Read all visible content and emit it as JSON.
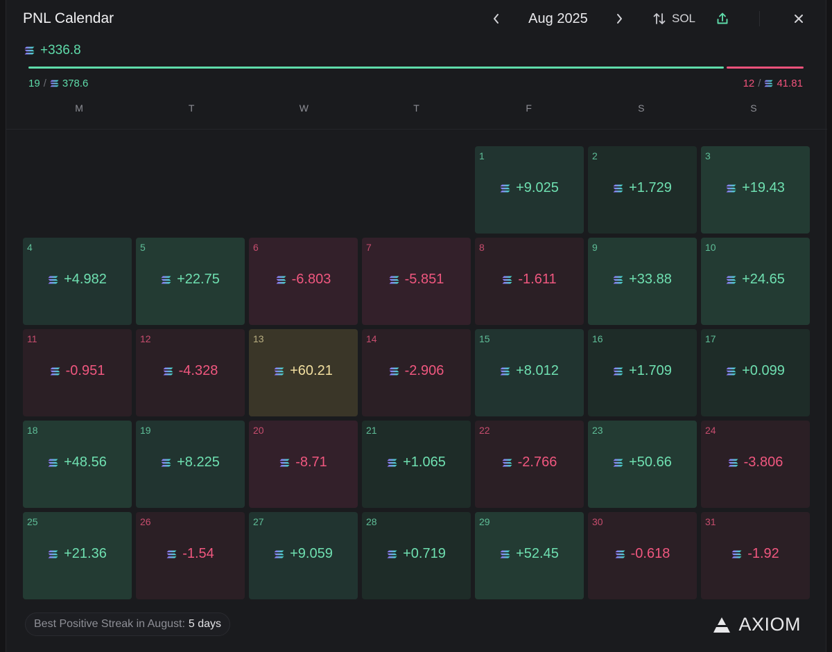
{
  "header": {
    "title": "PNL Calendar",
    "month": "Aug 2025",
    "unit_label": "SOL"
  },
  "summary": {
    "total": "+336.8",
    "wins_count": "19",
    "wins_amount": "378.6",
    "losses_count": "12",
    "losses_amount": "41.81",
    "win_share": 0.9
  },
  "weekdays": [
    "M",
    "T",
    "W",
    "T",
    "F",
    "S",
    "S"
  ],
  "days": [
    {
      "day": "1",
      "value": "+9.025"
    },
    {
      "day": "2",
      "value": "+1.729"
    },
    {
      "day": "3",
      "value": "+19.43"
    },
    {
      "day": "4",
      "value": "+4.982"
    },
    {
      "day": "5",
      "value": "+22.75"
    },
    {
      "day": "6",
      "value": "-6.803"
    },
    {
      "day": "7",
      "value": "-5.851"
    },
    {
      "day": "8",
      "value": "-1.611"
    },
    {
      "day": "9",
      "value": "+33.88"
    },
    {
      "day": "10",
      "value": "+24.65"
    },
    {
      "day": "11",
      "value": "-0.951"
    },
    {
      "day": "12",
      "value": "-4.328"
    },
    {
      "day": "13",
      "value": "+60.21"
    },
    {
      "day": "14",
      "value": "-2.906"
    },
    {
      "day": "15",
      "value": "+8.012"
    },
    {
      "day": "16",
      "value": "+1.709"
    },
    {
      "day": "17",
      "value": "+0.099"
    },
    {
      "day": "18",
      "value": "+48.56"
    },
    {
      "day": "19",
      "value": "+8.225"
    },
    {
      "day": "20",
      "value": "-8.71"
    },
    {
      "day": "21",
      "value": "+1.065"
    },
    {
      "day": "22",
      "value": "-2.766"
    },
    {
      "day": "23",
      "value": "+50.66"
    },
    {
      "day": "24",
      "value": "-3.806"
    },
    {
      "day": "25",
      "value": "+21.36"
    },
    {
      "day": "26",
      "value": "-1.54"
    },
    {
      "day": "27",
      "value": "+9.059"
    },
    {
      "day": "28",
      "value": "+0.719"
    },
    {
      "day": "29",
      "value": "+52.45"
    },
    {
      "day": "30",
      "value": "-0.618"
    },
    {
      "day": "31",
      "value": "-1.92"
    }
  ],
  "footer": {
    "streak_label": "Best Positive Streak in August:",
    "streak_value": "5 days",
    "brand": "AXIOM"
  },
  "colors": {
    "positive": "#5fdcaa",
    "negative": "#f0527b",
    "best_day": "#f2dfa0",
    "background": "#1a1b1e"
  },
  "icons": {
    "prev": "chevron-left-icon",
    "next": "chevron-right-icon",
    "unit_toggle": "swap-vertical-icon",
    "export": "share-upload-icon",
    "close": "close-icon",
    "currency": "solana-icon",
    "brand": "axiom-logo-icon"
  }
}
